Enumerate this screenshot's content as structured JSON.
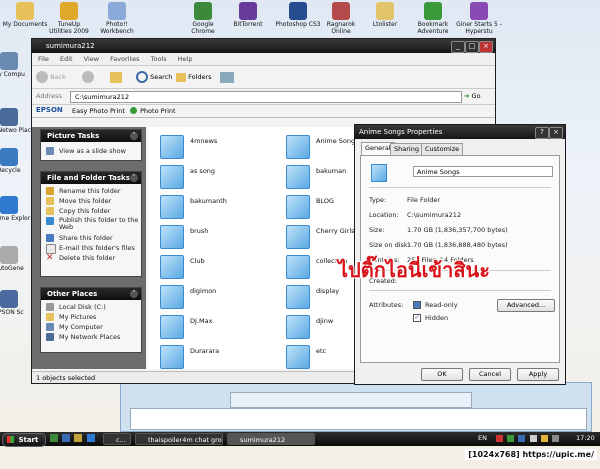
{
  "desktop": {
    "top_icons": [
      {
        "label": "My Documents",
        "color": "#e8c15a"
      },
      {
        "label": "TuneUp Utilities 2009",
        "color": "#e0a82a"
      },
      {
        "label": "Photo!! Workbench",
        "color": "#8aa8d8"
      },
      {
        "label": "Google Chrome",
        "color": "#3a8a3a"
      },
      {
        "label": "BitTorrent",
        "color": "#6a3a9a"
      },
      {
        "label": "Photoshop CS3",
        "color": "#254d8f"
      },
      {
        "label": "Ragnarok Online",
        "color": "#b44a4a"
      },
      {
        "label": "Ltolister",
        "color": "#e2c46a"
      },
      {
        "label": "Bookmark Adventure",
        "color": "#3a9a3a"
      },
      {
        "label": "Giner Starts 5 - Hyperstu",
        "color": "#8a4ab4"
      }
    ],
    "left_icons": [
      {
        "label": "My Compu",
        "color": "#6a8ab4"
      },
      {
        "label": "My Netwo Plac",
        "color": "#4a6a9a"
      },
      {
        "label": "Recycle",
        "color": "#3a7ac0"
      },
      {
        "label": "Interne Explor",
        "color": "#2f79d1"
      },
      {
        "label": "AutoGene",
        "color": "#aaaaaa"
      },
      {
        "label": "EPSON Sc",
        "color": "#4a6aa0"
      }
    ]
  },
  "explorer": {
    "title": "sumimura212",
    "menu": [
      "File",
      "Edit",
      "View",
      "Favorites",
      "Tools",
      "Help"
    ],
    "toolbar": {
      "back": "Back",
      "search": "Search",
      "folders": "Folders"
    },
    "address_label": "Address",
    "address_value": "C:\\sumimura212",
    "go_label": "Go",
    "epson_label": "EPSON",
    "easy_photo_print": "Easy Photo Print",
    "photo_print": "Photo Print",
    "picture_tasks": {
      "title": "Picture Tasks",
      "items": [
        "View as a slide show"
      ]
    },
    "file_folder_tasks": {
      "title": "File and Folder Tasks",
      "items": [
        "Rename this folder",
        "Move this folder",
        "Copy this folder",
        "Publish this folder to the Web",
        "Share this folder",
        "E-mail this folder's files",
        "Delete this folder"
      ]
    },
    "other_places": {
      "title": "Other Places",
      "items": [
        "Local Disk (C:)",
        "My Pictures",
        "My Computer",
        "My Network Places"
      ]
    },
    "folders_col1": [
      "4mnews",
      "as song",
      "bakumanth",
      "brush",
      "Club",
      "digimon",
      "DJ.Max",
      "Durarara"
    ],
    "folders_col2": [
      "Anime Songs",
      "bakuman",
      "BLOG",
      "Cherry Girls",
      "collection",
      "display",
      "djinw",
      "etc"
    ],
    "status": "1 objects selected"
  },
  "properties": {
    "title": "Anime Songs Properties",
    "tabs": [
      "General",
      "Sharing",
      "Customize"
    ],
    "folder_name": "Anime Songs",
    "type_label": "Type:",
    "type_value": "File Folder",
    "location_label": "Location:",
    "location_value": "C:\\sumimura212",
    "size_label": "Size:",
    "size_value": "1.70 GB (1,836,357,700 bytes)",
    "size_on_disk_label": "Size on disk:",
    "size_on_disk_value": "1.70 GB (1,836,888,480 bytes)",
    "contains_label": "Contains:",
    "contains_value": "257 Files, 14 Folders",
    "created_label": "Created:",
    "attributes_label": "Attributes:",
    "readonly_label": "Read-only",
    "hidden_label": "Hidden",
    "advanced_label": "Advanced...",
    "ok_label": "OK",
    "cancel_label": "Cancel",
    "apply_label": "Apply"
  },
  "overlay_text": "ไปติ๊กไอนี่เข้าสินะ",
  "overlay_color": "#d8141a",
  "taskbar": {
    "start": "Start",
    "items": [
      "c...",
      "thaispoiler4m chat gro...",
      "sumimura212"
    ],
    "lang": "EN",
    "clock": "17:20"
  },
  "watermark": "[1024x768] https://upic.me/"
}
